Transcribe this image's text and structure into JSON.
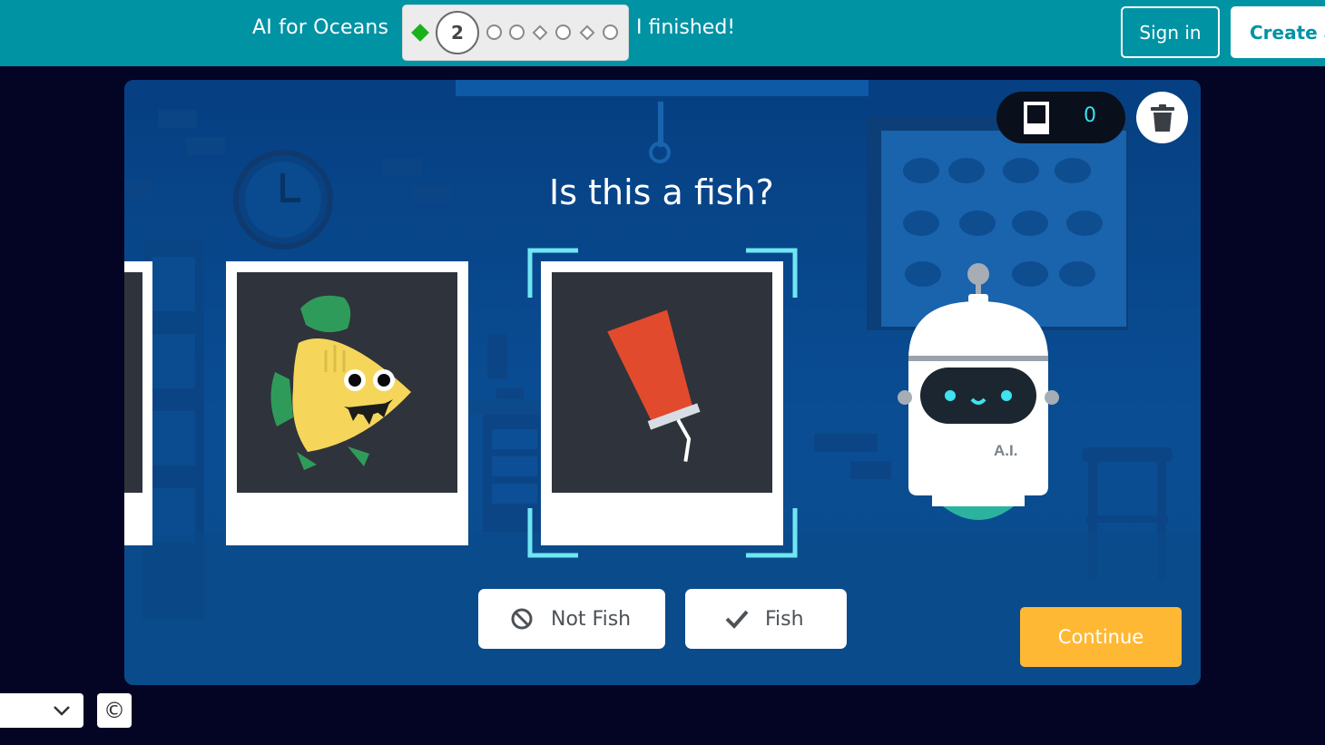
{
  "header": {
    "course_title": "AI for Oceans",
    "current_level": "2",
    "finished_label": "I finished!",
    "sign_in_label": "Sign in",
    "create_label": "Create a"
  },
  "scene": {
    "counter_value": "0",
    "question": "Is this a fish?",
    "robot_label": "A.I."
  },
  "buttons": {
    "not_fish_label": "Not Fish",
    "fish_label": "Fish",
    "continue_label": "Continue"
  },
  "footer": {
    "copyright_symbol": "©"
  },
  "colors": {
    "header_bg": "#0093a4",
    "page_bg": "#040424",
    "accent_continue": "#ffb833",
    "progress_done": "#1bb11b",
    "scan_bracket": "#6fe6f2"
  },
  "icons": [
    "photo-counter-icon",
    "trash-icon",
    "not-allowed-icon",
    "checkmark-icon",
    "chevron-down-icon",
    "copyright-icon"
  ]
}
